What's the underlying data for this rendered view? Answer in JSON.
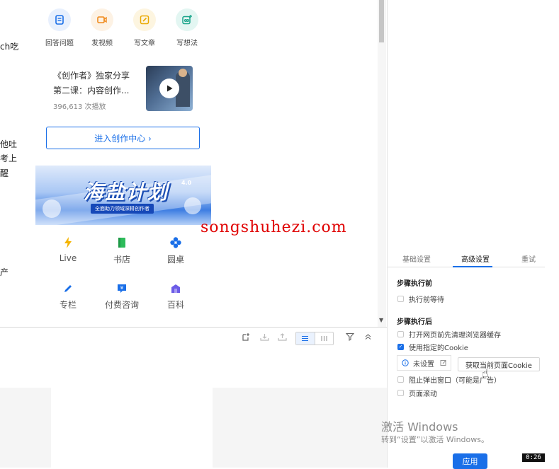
{
  "left_fragments": [
    "ch吃",
    "他吐",
    "考上",
    "醒",
    "产"
  ],
  "quick_actions": [
    {
      "label": "回答问题",
      "icon": "answer-icon",
      "bg": "#e8f0fd",
      "color": "#1a6fe8"
    },
    {
      "label": "发视频",
      "icon": "video-icon",
      "bg": "#fdf2e4",
      "color": "#f08a1c"
    },
    {
      "label": "写文章",
      "icon": "edit-icon",
      "bg": "#fdf5e0",
      "color": "#e9a800"
    },
    {
      "label": "写想法",
      "icon": "idea-icon",
      "bg": "#e3f6f2",
      "color": "#17a389"
    }
  ],
  "promo": {
    "title_line1": "《创作者》独家分享",
    "title_line2": "第二课：内容创作...",
    "views": "396,613 次播放"
  },
  "creator_center_button": "进入创作中心 ›",
  "banner": {
    "title": "海盐计划",
    "subtitle": "全面助力领域深耕创作者",
    "badge": "4.0"
  },
  "grid_items": [
    {
      "label": "Live",
      "icon": "lightning-icon",
      "color": "#f5b400"
    },
    {
      "label": "书店",
      "icon": "book-icon",
      "color": "#2dbb5a"
    },
    {
      "label": "圆桌",
      "icon": "roundtable-icon",
      "color": "#1a6fe8"
    },
    {
      "label": "专栏",
      "icon": "pen-icon",
      "color": "#1a6fe8"
    },
    {
      "label": "付费咨询",
      "icon": "consult-icon",
      "color": "#1a6fe8"
    },
    {
      "label": "百科",
      "icon": "encyclopedia-icon",
      "color": "#6c5ce7"
    }
  ],
  "watermark": "songshuhezi.com",
  "settings": {
    "tabs": [
      "基础设置",
      "高级设置",
      "重试"
    ],
    "active_tab": "高级设置",
    "before_title": "步骤执行前",
    "before_options": [
      {
        "label": "执行前等待",
        "checked": false
      }
    ],
    "after_title": "步骤执行后",
    "after_options": [
      {
        "label": "打开网页前先清理浏览器缓存",
        "checked": false
      },
      {
        "label": "使用指定的Cookie",
        "checked": true
      }
    ],
    "cookie_status": "未设置",
    "get_cookie_button": "获取当前页面Cookie",
    "more_options": [
      {
        "label": "阻止弹出窗口（可能是广告）",
        "checked": false
      },
      {
        "label": "页面滚动",
        "checked": false
      }
    ]
  },
  "windows_activation": {
    "line1": "激活 Windows",
    "line2": "转到“设置”以激活 Windows。"
  },
  "apply_button": "应用",
  "timer": "0:26"
}
